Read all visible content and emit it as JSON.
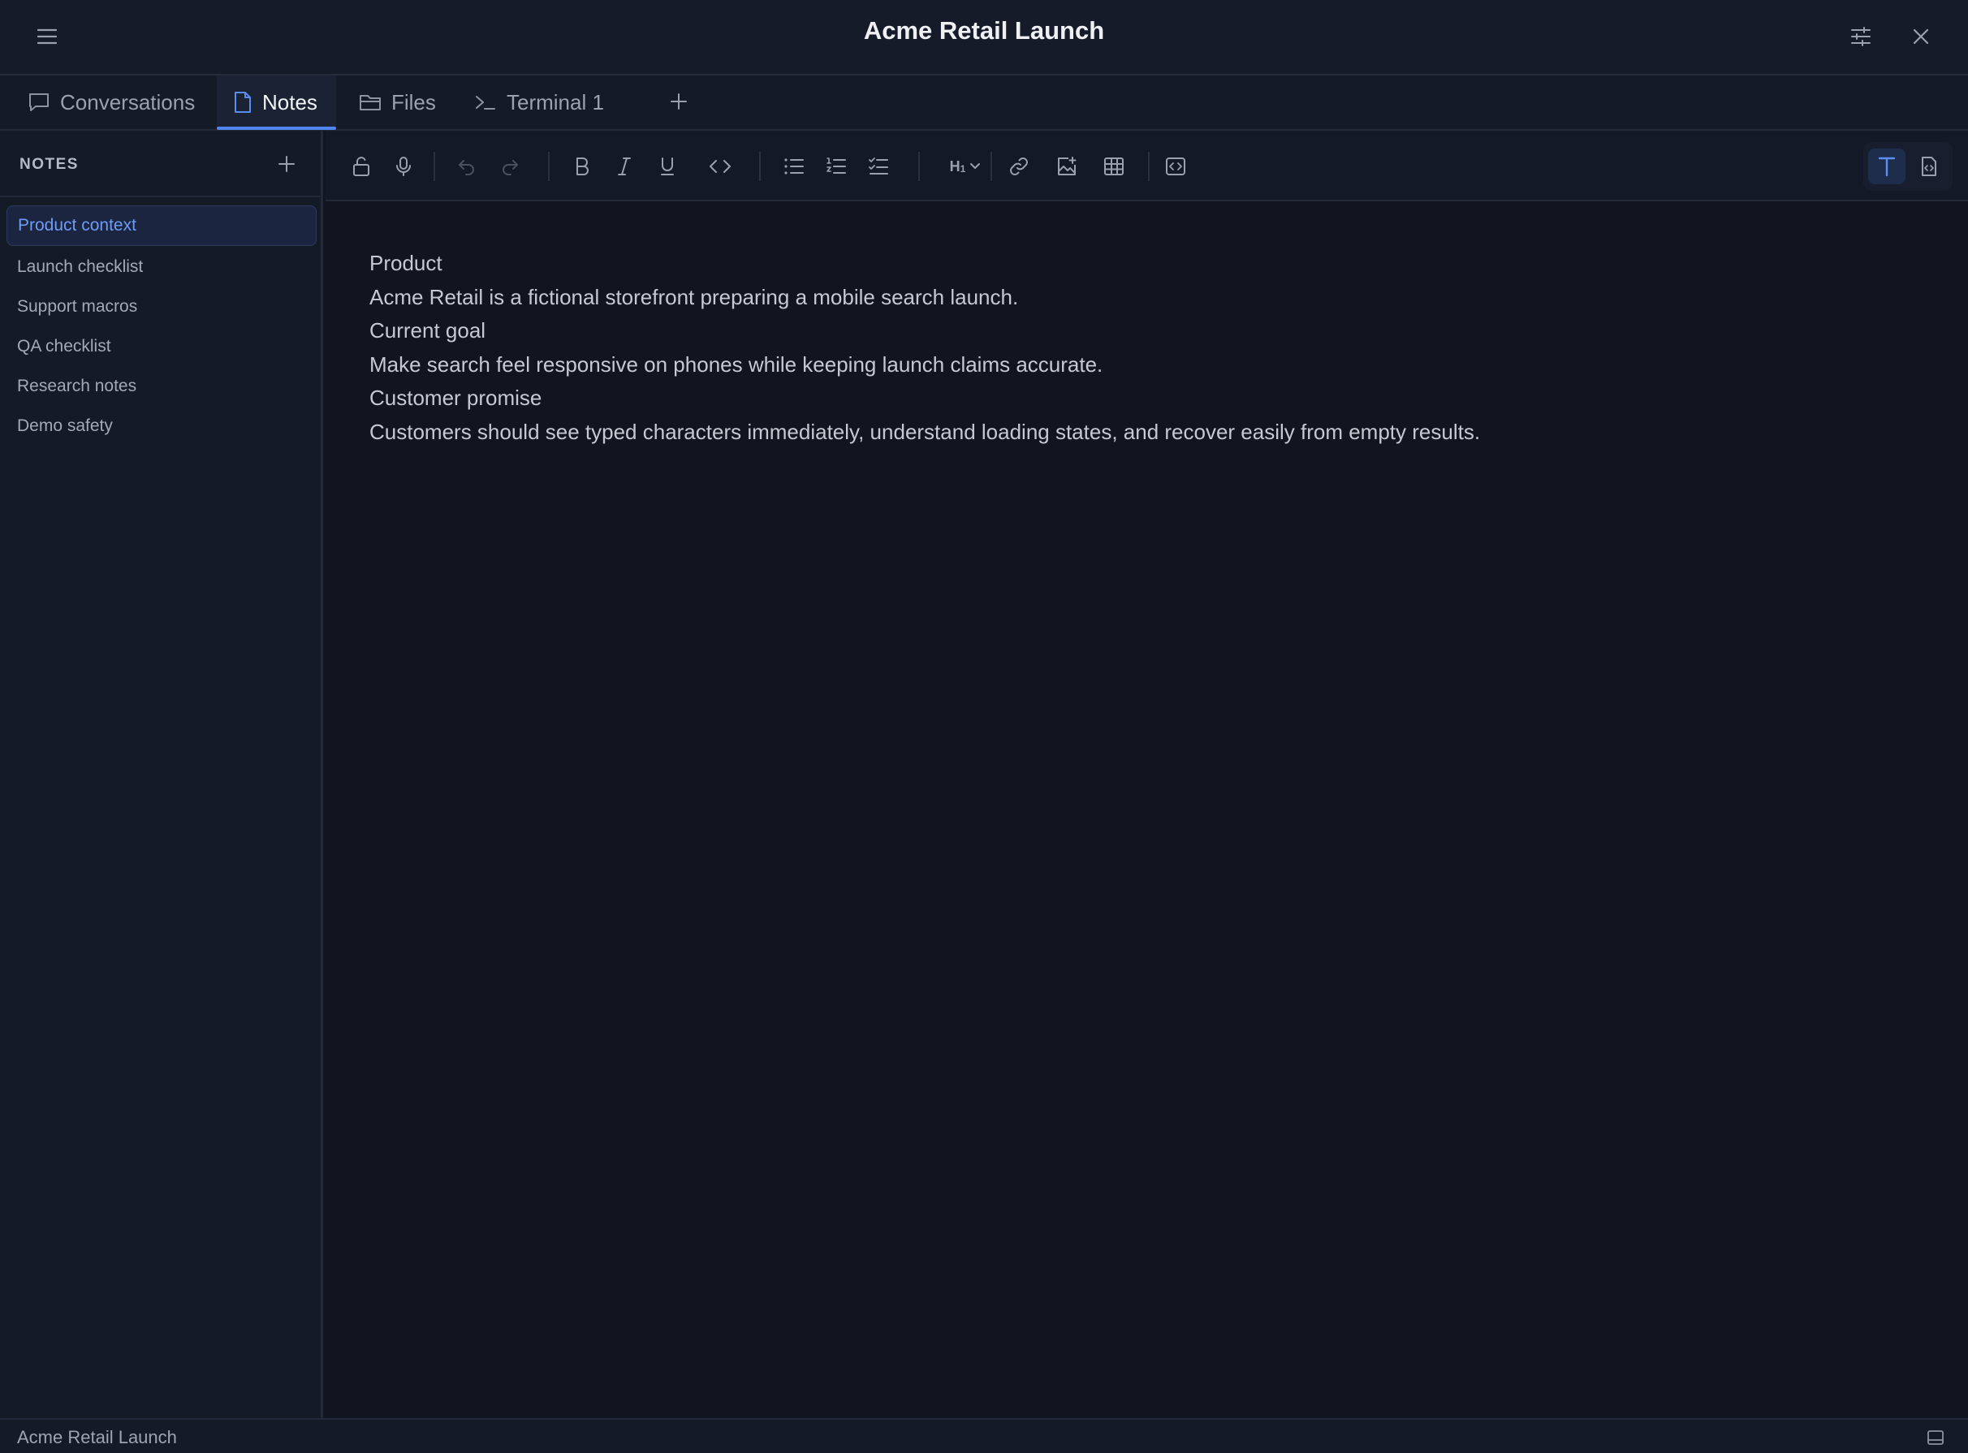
{
  "window": {
    "title": "Acme Retail Launch",
    "menu_icon": "hamburger-menu-icon",
    "settings_icon": "sliders-icon",
    "close_icon": "close-icon"
  },
  "tabs": [
    {
      "label": "Conversations",
      "icon": "chat-bubble-icon",
      "active": false
    },
    {
      "label": "Notes",
      "icon": "document-icon",
      "active": true
    },
    {
      "label": "Files",
      "icon": "folder-icon",
      "active": false
    },
    {
      "label": "Terminal 1",
      "icon": "terminal-prompt-icon",
      "active": false
    }
  ],
  "sidebar": {
    "title": "NOTES",
    "items": [
      {
        "label": "Product context",
        "active": true
      },
      {
        "label": "Launch checklist",
        "active": false
      },
      {
        "label": "Support macros",
        "active": false
      },
      {
        "label": "QA checklist",
        "active": false
      },
      {
        "label": "Research notes",
        "active": false
      },
      {
        "label": "Demo safety",
        "active": false
      }
    ]
  },
  "toolbar": {
    "heading_level": "H",
    "heading_level_sub": "1",
    "tools": [
      "lock-icon",
      "microphone-icon",
      "undo-icon",
      "redo-icon",
      "bold-icon",
      "italic-icon",
      "underline-icon",
      "code-icon",
      "bullet-list-icon",
      "numbered-list-icon",
      "checklist-icon",
      "link-icon",
      "image-icon",
      "table-icon",
      "embed-icon"
    ],
    "modes": [
      "text-mode-icon",
      "source-mode-icon"
    ]
  },
  "editor": {
    "lines": [
      "Product",
      "Acme Retail is a fictional storefront preparing a mobile search launch.",
      "Current goal",
      "Make search feel responsive on phones while keeping launch claims accurate.",
      "Customer promise",
      "Customers should see typed characters immediately, understand loading states, and recover easily from empty results."
    ]
  },
  "status": {
    "text": "Acme Retail Launch",
    "panel_icon": "panel-toggle-icon"
  },
  "colors": {
    "accent": "#4f86f2",
    "background": "#121623",
    "sidebar_active_bg": "#1b2540"
  }
}
